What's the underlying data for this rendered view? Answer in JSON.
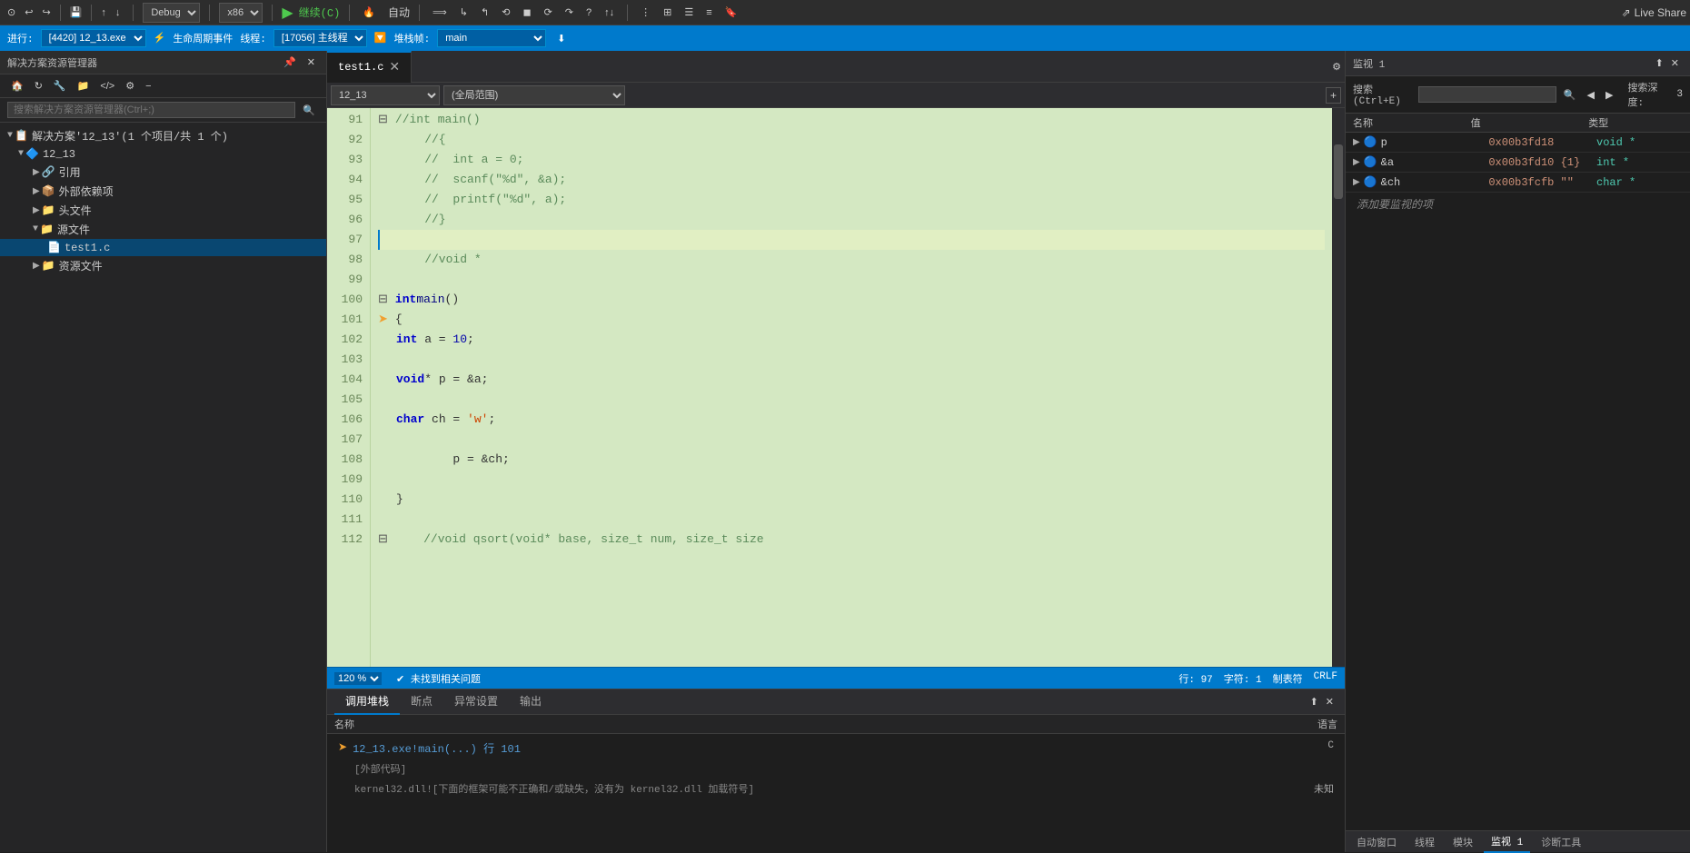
{
  "toolbar": {
    "debug_label": "Debug",
    "arch_label": "x86",
    "continue_label": "继续(C)",
    "auto_label": "自动",
    "live_share": "Live Share"
  },
  "debug_bar": {
    "process_label": "进行:",
    "process_value": "[4420] 12_13.exe",
    "lifecycle_label": "生命周期事件",
    "thread_label": "线程:",
    "thread_value": "[17056] 主线程",
    "stack_label": "堆栈帧:",
    "stack_value": "main"
  },
  "sidebar": {
    "header": "解决方案资源管理器",
    "search_placeholder": "搜索解决方案资源管理器(Ctrl+;)",
    "solution": "解决方案'12_13'(1 个项目/共 1 个)",
    "project": "12_13",
    "refs": "引用",
    "external_deps": "外部依赖项",
    "headers": "头文件",
    "sources": "源文件",
    "file": "test1.c",
    "resources": "资源文件"
  },
  "editor": {
    "tab_name": "test1.c",
    "nav_left": "12_13",
    "nav_mid": "(全局范围)",
    "lines": [
      {
        "num": 91,
        "text": "    //int main()",
        "type": "comment"
      },
      {
        "num": 92,
        "text": "    //{",
        "type": "comment"
      },
      {
        "num": 93,
        "text": "    //  int a = 0;",
        "type": "comment"
      },
      {
        "num": 94,
        "text": "    //  scanf(\"%d\", &a);",
        "type": "comment"
      },
      {
        "num": 95,
        "text": "    //  printf(\"%d\", a);",
        "type": "comment"
      },
      {
        "num": 96,
        "text": "    //}",
        "type": "comment"
      },
      {
        "num": 97,
        "text": "",
        "type": "empty",
        "current": true
      },
      {
        "num": 98,
        "text": "    //void *",
        "type": "comment"
      },
      {
        "num": 99,
        "text": "",
        "type": "empty"
      },
      {
        "num": 100,
        "text": "int main()",
        "type": "code",
        "fold": true
      },
      {
        "num": 101,
        "text": "{",
        "type": "code"
      },
      {
        "num": 102,
        "text": "        int a = 10;",
        "type": "code"
      },
      {
        "num": 103,
        "text": "",
        "type": "empty"
      },
      {
        "num": 104,
        "text": "        void* p = &a;",
        "type": "code"
      },
      {
        "num": 105,
        "text": "",
        "type": "empty"
      },
      {
        "num": 106,
        "text": "        char ch = 'w';",
        "type": "code"
      },
      {
        "num": 107,
        "text": "",
        "type": "empty"
      },
      {
        "num": 108,
        "text": "        p = &ch;",
        "type": "code"
      },
      {
        "num": 109,
        "text": "",
        "type": "empty"
      },
      {
        "num": 110,
        "text": "}",
        "type": "code"
      },
      {
        "num": 111,
        "text": "",
        "type": "empty"
      },
      {
        "num": 112,
        "text": "    //void qsort(void* base, size_t num, size_t size",
        "type": "comment",
        "partial": true
      }
    ],
    "zoom": "120 %",
    "status_left": "✔ 未找到相关问题",
    "row": "行: 97",
    "col": "字符: 1",
    "mode": "制表符",
    "encoding": "CRLF"
  },
  "watch": {
    "header": "监视 1",
    "search_placeholder": "搜索(Ctrl+E)",
    "depth_label": "搜索深度:",
    "depth_value": "3",
    "col_name": "名称",
    "col_value": "值",
    "col_type": "类型",
    "rows": [
      {
        "name": "p",
        "value": "0x00b3fd18",
        "type": "void *",
        "expanded": false
      },
      {
        "name": "&a",
        "value": "0x00b3fd10 {1}",
        "type": "int *",
        "expanded": false
      },
      {
        "name": "&ch",
        "value": "0x00b3fcfb \"\"",
        "type": "char *",
        "expanded": false
      }
    ],
    "add_label": "添加要监视的项",
    "bottom_tabs": [
      "自动窗口",
      "线程",
      "模块",
      "监视 1",
      "诊断工具"
    ]
  },
  "call_stack": {
    "header": "调用堆栈",
    "col_name": "名称",
    "col_lang": "语言",
    "rows": [
      {
        "name": "12_13.exe!main(...) 行 101",
        "lang": "C",
        "type": "current"
      },
      {
        "meta": "[外部代码]"
      },
      {
        "name": "kernel32.dll![下面的框架可能不正确和/或缺失，没有为 kernel32.dll 加载符号]",
        "lang": "未知",
        "type": "external"
      }
    ],
    "bottom_tabs": [
      "调用堆栈",
      "断点",
      "异常设置",
      "输出"
    ]
  }
}
